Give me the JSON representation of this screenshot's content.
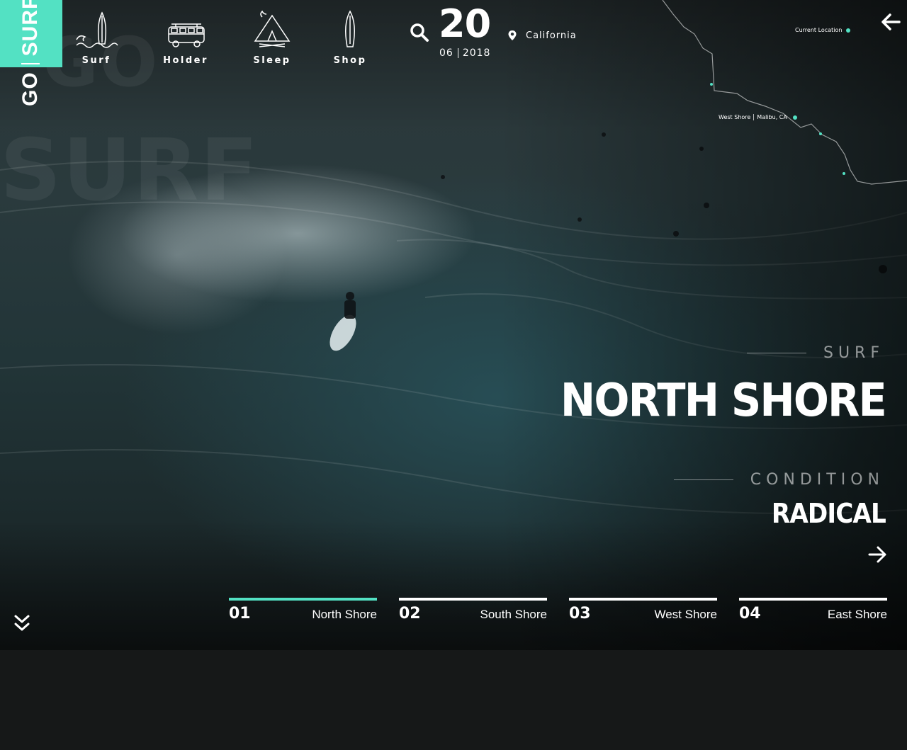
{
  "brand": {
    "go": "GO",
    "surf": "SURF",
    "accent": "#53e1c3"
  },
  "background_text": {
    "go": "GO",
    "surf": "SURF"
  },
  "nav": [
    {
      "label": "Surf",
      "icon": "surfboard-wave-icon"
    },
    {
      "label": "Holder",
      "icon": "van-icon"
    },
    {
      "label": "Sleep",
      "icon": "tent-campfire-icon"
    },
    {
      "label": "Shop",
      "icon": "surfboard-icon"
    }
  ],
  "date": {
    "day": "20",
    "month": "06",
    "year": "2018"
  },
  "location": {
    "name": "California"
  },
  "map": {
    "current_location": "Current Location",
    "shore": "West Shore",
    "place": "Malibu, CA"
  },
  "hero": {
    "kicker": "SURF",
    "title": "NORTH SHORE",
    "condition_label": "CONDITION",
    "condition": "RADICAL"
  },
  "tabs": [
    {
      "num": "01",
      "name": "North Shore",
      "active": true
    },
    {
      "num": "02",
      "name": "South Shore",
      "active": false
    },
    {
      "num": "03",
      "name": "West Shore",
      "active": false
    },
    {
      "num": "04",
      "name": "East Shore",
      "active": false
    }
  ]
}
